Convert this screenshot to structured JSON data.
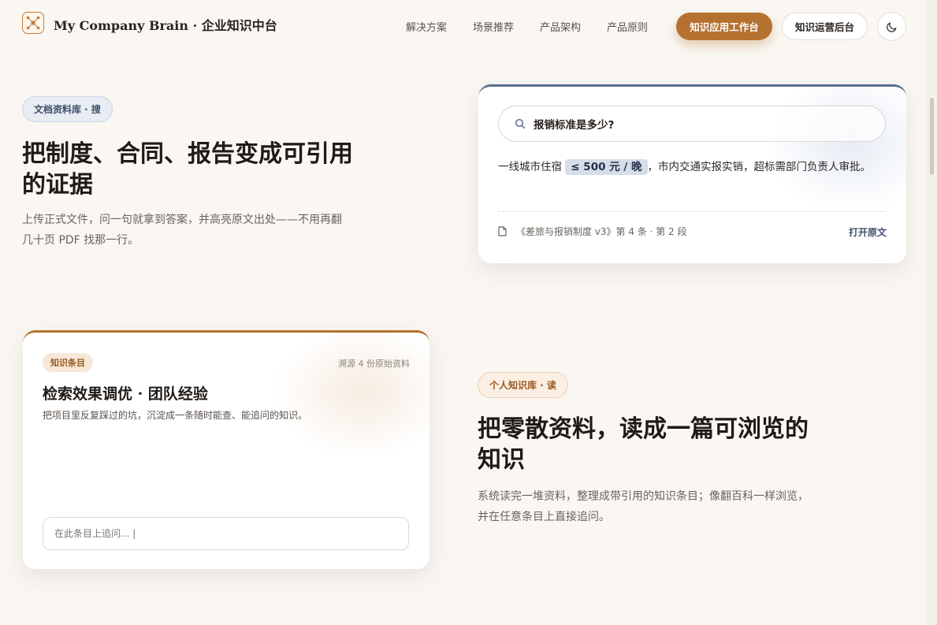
{
  "header": {
    "brand": "My Company Brain · 企业知识中台",
    "nav": [
      "解决方案",
      "场景推荐",
      "产品架构",
      "产品原则"
    ],
    "primary_button": "知识应用工作台",
    "secondary_button": "知识运营后台",
    "theme_icon": "moon-icon",
    "logo_icon": "network-logo-icon"
  },
  "section_docs": {
    "pill": "文档资料库 · 搜",
    "title_line1": "把制度、合同、报告变成可引用",
    "title_line2": "的证据",
    "desc_line1": "上传正式文件，问一句就拿到答案，并高亮原文出处——不用再翻",
    "desc_line2": "几十页 PDF 找那一行。",
    "card": {
      "query": "报销标准是多少?",
      "answer_pre": "一线城市住宿 ",
      "answer_highlight": "≤ 500 元 / 晚",
      "answer_post": "，市内交通实报实销，超标需部门负责人审批。",
      "citation": "《差旅与报销制度 v3》第 4 条 · 第 2 段",
      "open_source": "打开原文"
    }
  },
  "section_personal": {
    "card": {
      "tag": "知识条目",
      "source_count": "溯源 4 份原始资料",
      "title": "检索效果调优 · 团队经验",
      "desc": "把项目里反复踩过的坑，沉淀成一条随时能查、能追问的知识。",
      "input_placeholder": "在此条目上追问... |"
    },
    "pill": "个人知识库 · 读",
    "title_line1": "把零散资料，读成一篇可浏览的",
    "title_line2": "知识",
    "desc_line1": "系统读完一堆资料，整理成带引用的知识条目；像翻百科一样浏览，",
    "desc_line2": "并在任意条目上直接追问。"
  },
  "colors": {
    "background": "#faf7f2",
    "accent_orange": "#b5712f",
    "accent_blue": "#5b6f8c"
  }
}
